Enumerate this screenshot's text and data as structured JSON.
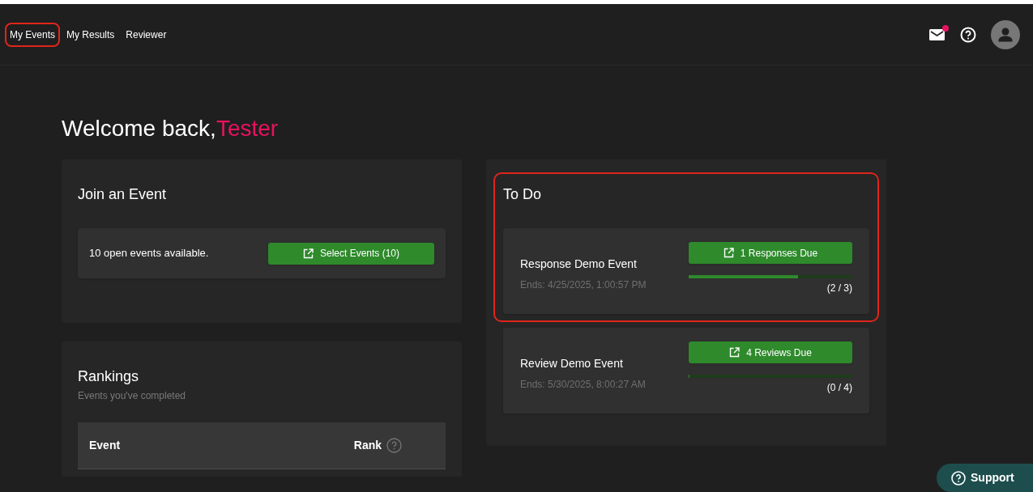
{
  "nav": [
    {
      "label": "My Events",
      "highlighted": true
    },
    {
      "label": "My Results",
      "highlighted": false
    },
    {
      "label": "Reviewer",
      "highlighted": false
    }
  ],
  "header": {
    "unread_mail": true
  },
  "welcome": {
    "greeting": "Welcome back,",
    "name": "Tester"
  },
  "join_event": {
    "title": "Join an Event",
    "message": "10 open events available.",
    "button": "Select Events (10)"
  },
  "rankings": {
    "title": "Rankings",
    "subtitle": "Events you've completed",
    "columns": [
      "Event",
      "Rank"
    ]
  },
  "to_do": {
    "title": "To Do",
    "highlighted": true,
    "items": [
      {
        "name": "Response Demo Event",
        "ends": "Ends: 4/25/2025, 1:00:57 PM",
        "button": "1 Responses Due",
        "level": 0.667,
        "count": "(2 / 3)"
      },
      {
        "name": "Review Demo Event",
        "ends": "Ends: 5/30/2025, 8:00:27 AM",
        "button": "4 Reviews Due",
        "level": 0,
        "count": "(0 / 4)"
      }
    ]
  },
  "support": {
    "label": "Support"
  }
}
